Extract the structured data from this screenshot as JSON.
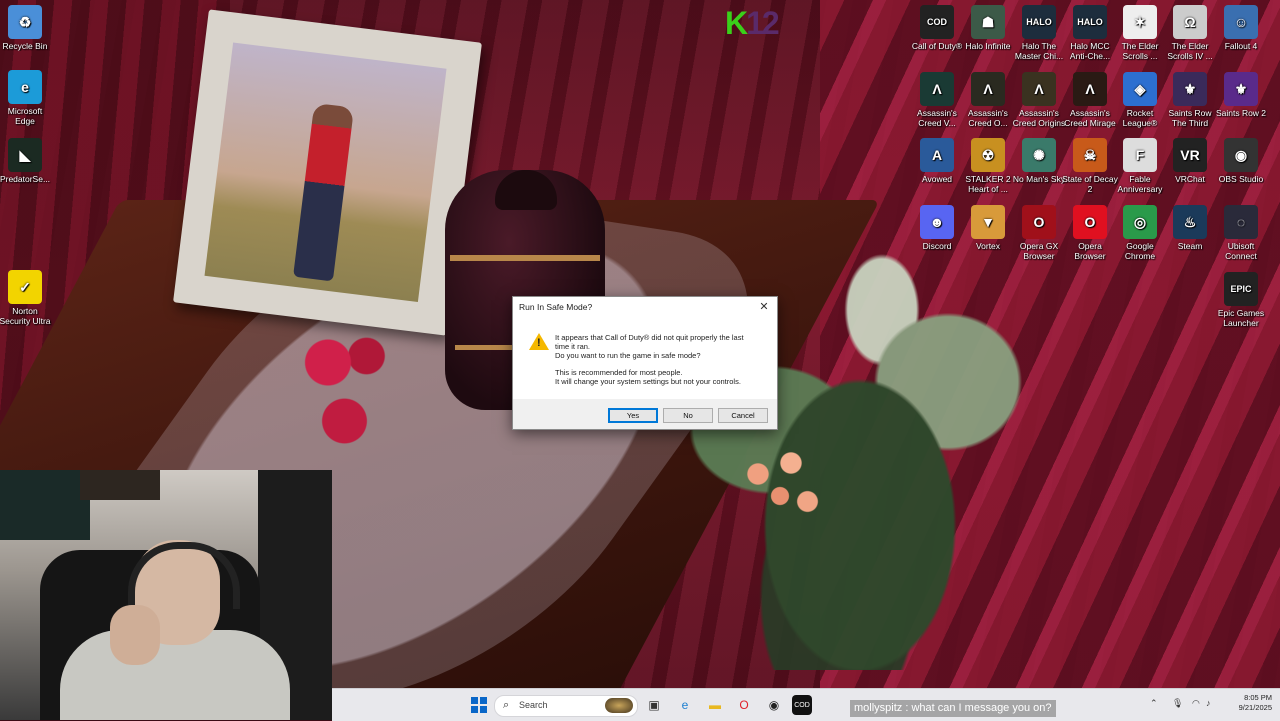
{
  "wallpaper": {
    "accent": "#7a1428"
  },
  "logo": {
    "k": "K",
    "n": "12"
  },
  "desktop_icons_left": [
    {
      "label": "Recycle Bin",
      "icon": "recycle-bin-icon",
      "glyph": "♻",
      "color": "#4a8fd8"
    },
    {
      "label": "Microsoft Edge",
      "icon": "edge-icon",
      "glyph": "e",
      "color": "#1c9bd8"
    },
    {
      "label": "PredatorSe...",
      "icon": "predator-sense-icon",
      "glyph": "◣",
      "color": "#1b2a22"
    },
    {
      "label": "Norton Security Ultra",
      "icon": "norton-icon",
      "glyph": "✓",
      "color": "#f2d400"
    }
  ],
  "desktop_icons_right": [
    {
      "label": "Call of Duty®",
      "icon": "call-of-duty-icon",
      "glyph": "COD",
      "color": "#222222"
    },
    {
      "label": "Halo Infinite",
      "icon": "halo-infinite-icon",
      "glyph": "☗",
      "color": "#3c5a48"
    },
    {
      "label": "Halo The Master Chi...",
      "icon": "halo-mcc-icon",
      "glyph": "HALO",
      "color": "#1d2d3d"
    },
    {
      "label": "Halo MCC Anti-Che...",
      "icon": "halo-mcc-anticheat-icon",
      "glyph": "HALO",
      "color": "#1d2d3d"
    },
    {
      "label": "The Elder Scrolls ...",
      "icon": "elder-scrolls-icon",
      "glyph": "✶",
      "color": "#eeeeee"
    },
    {
      "label": "The Elder Scrolls IV ...",
      "icon": "oblivion-icon",
      "glyph": "Ω",
      "color": "#cccccc"
    },
    {
      "label": "Fallout 4",
      "icon": "fallout-4-icon",
      "glyph": "☺",
      "color": "#3a6fb0"
    },
    {
      "label": "Assassin's Creed V...",
      "icon": "ac-valhalla-icon",
      "glyph": "Λ",
      "color": "#1a3a34"
    },
    {
      "label": "Assassin's Creed O...",
      "icon": "ac-odyssey-icon",
      "glyph": "Λ",
      "color": "#2a2a20"
    },
    {
      "label": "Assassin's Creed Origins",
      "icon": "ac-origins-icon",
      "glyph": "Λ",
      "color": "#3a3220"
    },
    {
      "label": "Assassin's Creed Mirage",
      "icon": "ac-mirage-icon",
      "glyph": "Λ",
      "color": "#2a1a14"
    },
    {
      "label": "Rocket League®",
      "icon": "rocket-league-icon",
      "glyph": "◈",
      "color": "#2c6fd0"
    },
    {
      "label": "Saints Row The Third",
      "icon": "saints-row-3-icon",
      "glyph": "⚜",
      "color": "#3a2a5a"
    },
    {
      "label": "Saints Row 2",
      "icon": "saints-row-2-icon",
      "glyph": "⚜",
      "color": "#5a2a8a"
    },
    {
      "label": "Avowed",
      "icon": "avowed-icon",
      "glyph": "A",
      "color": "#2a5a9a"
    },
    {
      "label": "STALKER 2 Heart of ...",
      "icon": "stalker-2-icon",
      "glyph": "☢",
      "color": "#c89020"
    },
    {
      "label": "No Man's Sky",
      "icon": "no-mans-sky-icon",
      "glyph": "✺",
      "color": "#3a7a6a"
    },
    {
      "label": "State of Decay 2",
      "icon": "state-of-decay-icon",
      "glyph": "☠",
      "color": "#c85a1a"
    },
    {
      "label": "Fable Anniversary",
      "icon": "fable-icon",
      "glyph": "F",
      "color": "#dddddd"
    },
    {
      "label": "VRChat",
      "icon": "vrchat-icon",
      "glyph": "VR",
      "color": "#222222"
    },
    {
      "label": "OBS Studio",
      "icon": "obs-icon",
      "glyph": "◉",
      "color": "#333333"
    },
    {
      "label": "Discord",
      "icon": "discord-icon",
      "glyph": "☻",
      "color": "#5865f2"
    },
    {
      "label": "Vortex",
      "icon": "vortex-icon",
      "glyph": "▼",
      "color": "#d89a3a"
    },
    {
      "label": "Opera GX Browser",
      "icon": "opera-gx-icon",
      "glyph": "O",
      "color": "#a0101a"
    },
    {
      "label": "Opera Browser",
      "icon": "opera-icon",
      "glyph": "O",
      "color": "#e01020"
    },
    {
      "label": "Google Chrome",
      "icon": "chrome-icon",
      "glyph": "◎",
      "color": "#2a9a4a"
    },
    {
      "label": "Steam",
      "icon": "steam-icon",
      "glyph": "♨",
      "color": "#1b3a5a"
    },
    {
      "label": "Ubisoft Connect",
      "icon": "ubisoft-icon",
      "glyph": "◌",
      "color": "#2a2a3a"
    },
    {
      "label": "Epic Games Launcher",
      "icon": "epic-games-icon",
      "glyph": "EPIC",
      "color": "#222222"
    }
  ],
  "dialog": {
    "title": "Run In Safe Mode?",
    "close": "✕",
    "line1": "It appears that Call of Duty® did not quit properly the last",
    "line2": "time it ran.",
    "line3": "Do you want to run the game in safe mode?",
    "line4": "This is recommended for most people.",
    "line5": "It will change your system settings but not your controls.",
    "yes": "Yes",
    "no": "No",
    "cancel": "Cancel"
  },
  "taskbar": {
    "search_placeholder": "Search",
    "search_icon": "⌕",
    "apps": [
      {
        "name": "task-view-icon",
        "glyph": "▣",
        "color": "#333333"
      },
      {
        "name": "edge-taskbar-icon",
        "glyph": "e",
        "color": "#1c7fd0"
      },
      {
        "name": "file-explorer-icon",
        "glyph": "▬",
        "color": "#e8b820"
      },
      {
        "name": "opera-taskbar-icon",
        "glyph": "O",
        "color": "#e0202a"
      },
      {
        "name": "obs-taskbar-icon",
        "glyph": "◉",
        "color": "#222222"
      },
      {
        "name": "call-of-duty-taskbar-icon",
        "glyph": "COD",
        "color": "#111111"
      }
    ],
    "clock_time": "8:05 PM",
    "clock_date": "9/21/2025"
  },
  "chat": {
    "user": "mollyspitz",
    "message": ": what can I message you on?"
  }
}
